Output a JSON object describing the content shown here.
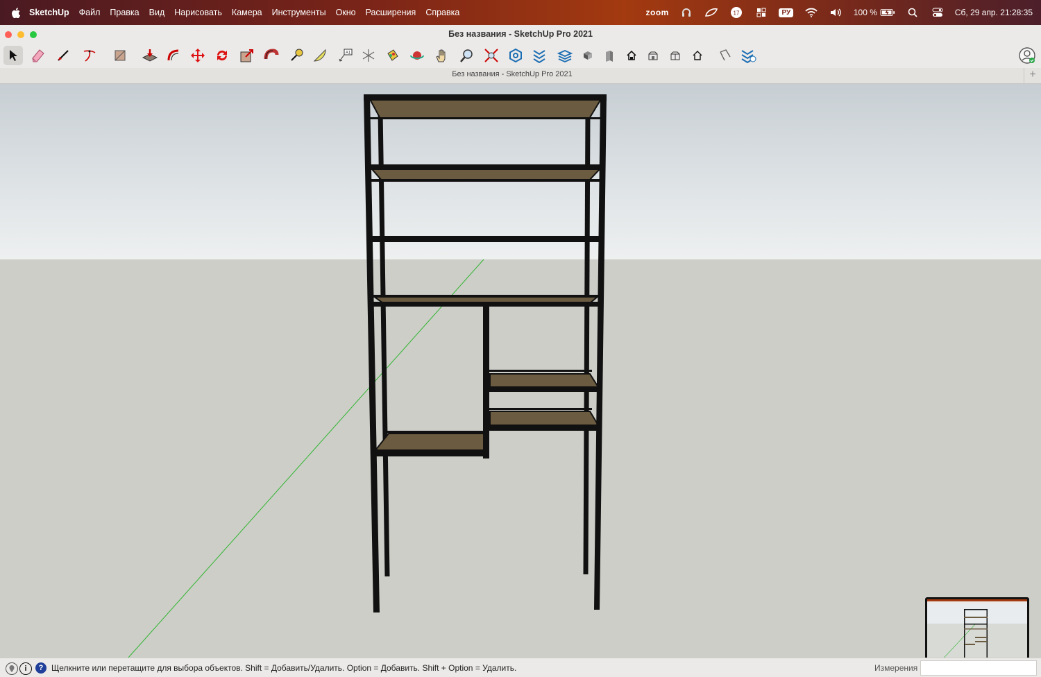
{
  "menubar": {
    "app_name": "SketchUp",
    "items": [
      "Файл",
      "Правка",
      "Вид",
      "Нарисовать",
      "Камера",
      "Инструменты",
      "Окно",
      "Расширения",
      "Справка"
    ],
    "zoom_label": "zoom",
    "notification_count": "17",
    "keyboard_layout": "РУ",
    "battery": "100 %",
    "datetime": "Сб, 29 апр.  21:28:35"
  },
  "window": {
    "title": "Без названия - SketchUp Pro 2021",
    "doc_tab": "Без названия - SketchUp Pro 2021",
    "add_tab": "+"
  },
  "toolbar": {
    "tools": [
      "select",
      "eraser",
      "line",
      "arc",
      "rectangle",
      "push-pull",
      "offset",
      "move",
      "rotate",
      "scale",
      "follow-me",
      "tape-measure",
      "protractor",
      "text",
      "axes",
      "paint-bucket",
      "orbit",
      "pan",
      "zoom",
      "zoom-extents",
      "3d-warehouse",
      "extension-warehouse",
      "layout",
      "extension-manager",
      "iso-view",
      "top-view",
      "front-view",
      "right-view",
      "back-view",
      "left-view",
      "section-plane",
      "styles"
    ]
  },
  "statusbar": {
    "hint": "Щелкните или перетащите для выбора объектов. Shift = Добавить/Удалить. Option = Добавить. Shift + Option = Удалить.",
    "measurements_label": "Измерения",
    "measurements_value": ""
  },
  "colors": {
    "menubar_accent": "#a33a10",
    "sky": "#dde2e5",
    "ground": "#cdcec8",
    "frame": "#111111",
    "wood": "#6b5b40",
    "green_axis": "#2fb52f"
  }
}
